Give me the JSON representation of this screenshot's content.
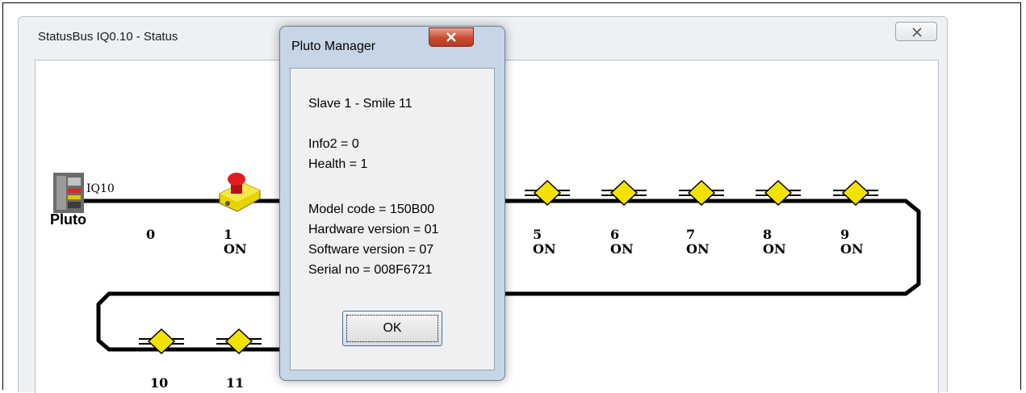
{
  "window": {
    "title": "StatusBus  IQ0.10 - Status"
  },
  "bus": {
    "master": {
      "name": "Pluto",
      "address": "IQ10"
    },
    "nodes": [
      {
        "id": "0",
        "state": ""
      },
      {
        "id": "1",
        "state": "ON"
      },
      {
        "id": "5",
        "state": "ON"
      },
      {
        "id": "6",
        "state": "ON"
      },
      {
        "id": "7",
        "state": "ON"
      },
      {
        "id": "8",
        "state": "ON"
      },
      {
        "id": "9",
        "state": "ON"
      },
      {
        "id": "10",
        "state": ""
      },
      {
        "id": "11",
        "state": ""
      }
    ]
  },
  "dialog": {
    "title": "Pluto Manager",
    "slave": "Slave 1 - Smile 11",
    "info2": "Info2 = 0",
    "health": "Health = 1",
    "model_code": "Model code = 150B00",
    "hardware_version": "Hardware version = 01",
    "software_version": "Software version = 07",
    "serial_no": "Serial no = 008F6721",
    "ok_label": "OK"
  },
  "colors": {
    "sensor_yellow": "#f2e200",
    "stop_button_red": "#d8161b",
    "dialog_close_red": "#c84b31"
  }
}
